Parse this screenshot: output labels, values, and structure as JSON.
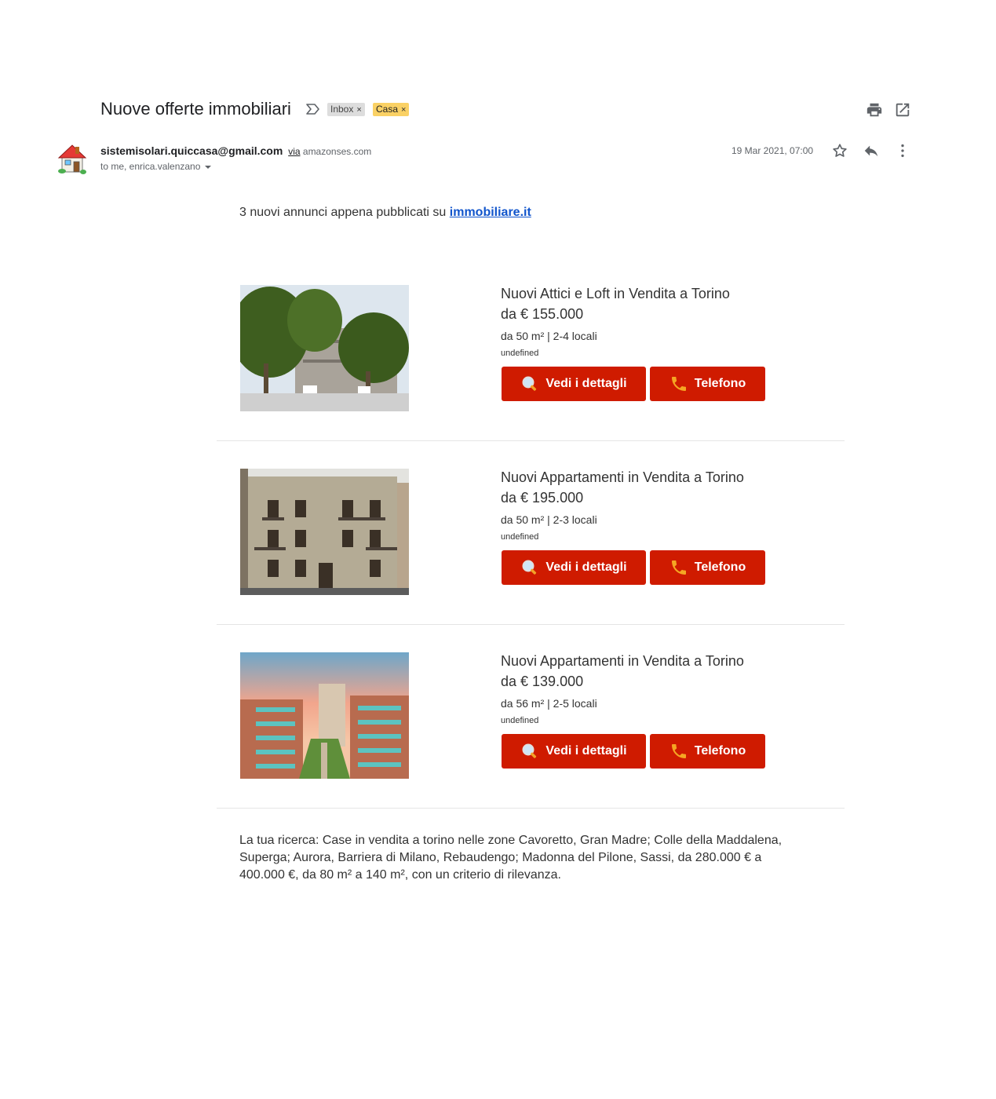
{
  "email": {
    "subject": "Nuove offerte immobiliari",
    "labels": [
      "Inbox",
      "Casa"
    ],
    "label_colors": {
      "Inbox": "#dddddd",
      "Casa": "#fad165"
    },
    "sender": "sistemisolari.quiccasa@gmail.com",
    "via_label": "via",
    "via_domain": "amazonses.com",
    "recipients": "to me, enrica.valenzano",
    "date": "19 Mar 2021, 07:00"
  },
  "body": {
    "intro": "3 nuovi annunci appena pubblicati su ",
    "intro_link": "immobiliare.it",
    "listings": [
      {
        "title": "Nuovi Attici e Loft in Vendita a Torino",
        "price": "da € 155.000",
        "info": "da 50 m² | 2-4 locali",
        "note": "undefined",
        "details_label": "Vedi i dettagli",
        "phone_label": "Telefono"
      },
      {
        "title": "Nuovi Appartamenti in Vendita a Torino",
        "price": "da € 195.000",
        "info": "da 50 m² | 2-3 locali",
        "note": "undefined",
        "details_label": "Vedi i dettagli",
        "phone_label": "Telefono"
      },
      {
        "title": "Nuovi Appartamenti in Vendita a Torino",
        "price": "da € 139.000",
        "info": "da 56 m² | 2-5 locali",
        "note": "undefined",
        "details_label": "Vedi i dettagli",
        "phone_label": "Telefono"
      }
    ],
    "search_summary": "La tua ricerca: Case in vendita a torino nelle zone Cavoretto, Gran Madre; Colle della Maddalena, Superga; Aurora, Barriera di Milano, Rebaudengo; Madonna del Pilone, Sassi, da 280.000 € a 400.000 €, da 80 m² a 140 m², con un criterio di rilevanza."
  },
  "icons": {
    "print": "print-icon",
    "new_window": "open-in-new-window-icon",
    "star": "star-icon",
    "reply": "reply-icon",
    "more": "more-vertical-icon",
    "search": "magnifier-icon",
    "phone": "phone-icon"
  },
  "colors": {
    "button": "#cf1b00",
    "link": "#1155cc"
  }
}
